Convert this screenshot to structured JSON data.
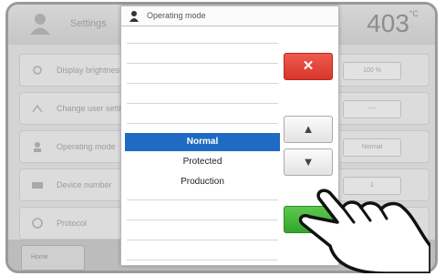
{
  "background": {
    "title": "Settings",
    "temperature": "403",
    "temperature_unit": "°C",
    "rows": [
      {
        "label": "Display brightness",
        "value": "100 %",
        "icon": "brightness-icon"
      },
      {
        "label": "Change user settings",
        "value": "----",
        "icon": "user-settings-icon"
      },
      {
        "label": "Operating mode",
        "value": "Normal",
        "icon": "operating-mode-icon"
      },
      {
        "label": "Device number",
        "value": "1",
        "icon": "device-icon"
      },
      {
        "label": "Protocol",
        "value": "",
        "icon": "protocol-icon"
      }
    ],
    "footer_tab": "Home"
  },
  "dialog": {
    "title": "Operating mode",
    "icon": "user-icon",
    "options": [
      "Normal",
      "Protected",
      "Production"
    ],
    "selected": "Normal",
    "cancel_label": "✕",
    "up_label": "▲",
    "down_label": "▼"
  },
  "colors": {
    "selected": "#1f6bc3",
    "cancel": "#e04a3e",
    "confirm": "#45b83a"
  }
}
